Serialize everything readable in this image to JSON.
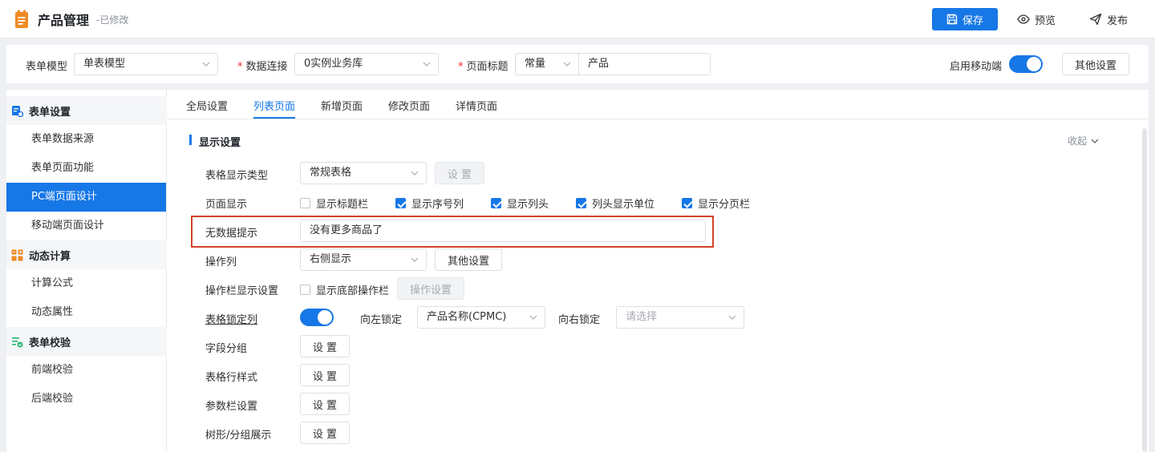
{
  "header": {
    "title": "产品管理",
    "status": "-已修改",
    "save_label": "保存",
    "preview_label": "预览",
    "publish_label": "发布"
  },
  "config": {
    "form_model_label": "表单模型",
    "form_model_value": "单表模型",
    "data_conn_label": "数据连接",
    "data_conn_value": "0实例业务库",
    "page_title_label": "页面标题",
    "page_title_type": "常量",
    "page_title_value": "产品",
    "mobile_label": "启用移动端",
    "mobile_enabled": true,
    "other_settings_label": "其他设置"
  },
  "sidebar": {
    "groups": [
      {
        "label": "表单设置",
        "icon": "form-settings-icon",
        "items": [
          "表单数据来源",
          "表单页面功能",
          "PC端页面设计",
          "移动端页面设计"
        ]
      },
      {
        "label": "动态计算",
        "icon": "calculator-icon",
        "items": [
          "计算公式",
          "动态属性"
        ]
      },
      {
        "label": "表单校验",
        "icon": "validation-icon",
        "items": [
          "前端校验",
          "后端校验"
        ]
      }
    ],
    "active_item": "PC端页面设计"
  },
  "tabs": [
    "全局设置",
    "列表页面",
    "新增页面",
    "修改页面",
    "详情页面"
  ],
  "active_tab": "列表页面",
  "section": {
    "title": "显示设置",
    "collapse_label": "收起",
    "table_type_label": "表格显示类型",
    "table_type_value": "常规表格",
    "table_type_btn": "设 置",
    "page_display_label": "页面显示",
    "page_display_options": [
      {
        "label": "显示标题栏",
        "checked": false
      },
      {
        "label": "显示序号列",
        "checked": true
      },
      {
        "label": "显示列头",
        "checked": true
      },
      {
        "label": "列头显示单位",
        "checked": true
      },
      {
        "label": "显示分页栏",
        "checked": true
      }
    ],
    "no_data_label": "无数据提示",
    "no_data_value": "没有更多商品了",
    "op_col_label": "操作列",
    "op_col_value": "右侧显示",
    "op_col_btn": "其他设置",
    "op_bar_label": "操作栏显示设置",
    "op_bar_check": "显示底部操作栏",
    "op_bar_btn": "操作设置",
    "lock_label": "表格锁定列",
    "lock_enabled": true,
    "lock_left_label": "向左锁定",
    "lock_left_value": "产品名称(CPMC)",
    "lock_right_label": "向右锁定",
    "lock_right_placeholder": "请选择",
    "field_group_label": "字段分组",
    "row_style_label": "表格行样式",
    "param_bar_label": "参数栏设置",
    "tree_label": "树形/分组展示",
    "set_btn": "设 置"
  },
  "colors": {
    "accent": "#1677e6",
    "highlight": "#d0432a",
    "orange": "#f08a24",
    "green": "#2bb673"
  }
}
